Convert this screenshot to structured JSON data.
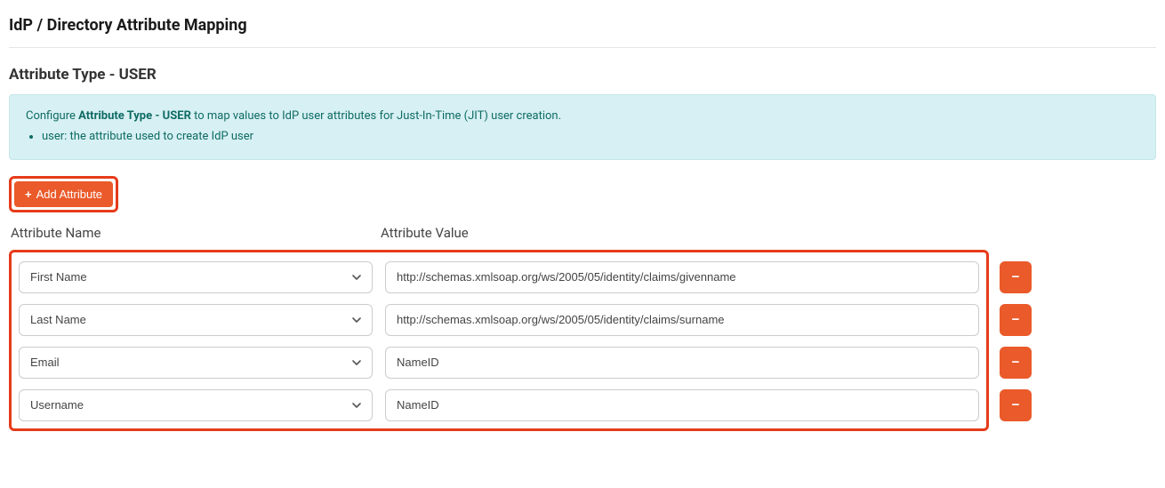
{
  "page_title": "IdP / Directory Attribute Mapping",
  "section_title": "Attribute Type - USER",
  "info": {
    "prefix": "Configure ",
    "bold": "Attribute Type - USER",
    "suffix": " to map values to IdP user attributes for Just-In-Time (JIT) user creation.",
    "bullet": "user: the attribute used to create IdP user"
  },
  "add_button_label": "Add Attribute",
  "headers": {
    "name": "Attribute Name",
    "value": "Attribute Value"
  },
  "rows": [
    {
      "name": "First Name",
      "value": "http://schemas.xmlsoap.org/ws/2005/05/identity/claims/givenname"
    },
    {
      "name": "Last Name",
      "value": "http://schemas.xmlsoap.org/ws/2005/05/identity/claims/surname"
    },
    {
      "name": "Email",
      "value": "NameID"
    },
    {
      "name": "Username",
      "value": "NameID"
    }
  ],
  "colors": {
    "accent": "#ea5a2a",
    "highlight_border": "#e63b1a",
    "info_bg": "#d7f0f3",
    "info_text": "#0e6b64"
  }
}
